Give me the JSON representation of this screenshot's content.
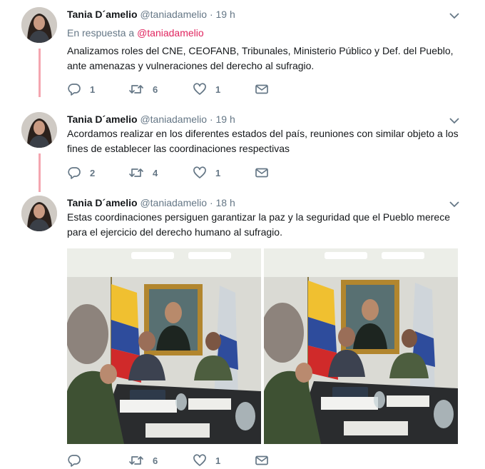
{
  "tweets": [
    {
      "fullname": "Tania D´amelio",
      "username": "@taniadamelio",
      "dot": "·",
      "time": "19 h",
      "reply_prefix": "En respuesta a",
      "reply_handle": "@taniadamelio",
      "text": "Analizamos roles del CNE, CEOFANB, Tribunales, Ministerio Público y Def. del Pueblo, ante amenazas y vulneraciones del derecho al sufragio.",
      "replies": "1",
      "retweets": "6",
      "likes": "1"
    },
    {
      "fullname": "Tania D´amelio",
      "username": "@taniadamelio",
      "dot": "·",
      "time": "19 h",
      "text": "Acordamos realizar en los diferentes estados del país, reuniones con similar objeto a los fines de establecer las coordinaciones respectivas",
      "replies": "2",
      "retweets": "4",
      "likes": "1"
    },
    {
      "fullname": "Tania D´amelio",
      "username": "@taniadamelio",
      "dot": "·",
      "time": "18 h",
      "text": "Estas coordinaciones persiguen garantizar  la paz y la seguridad que el Pueblo merece para el ejercicio del derecho humano al sufragio.",
      "replies": "",
      "retweets": "6",
      "likes": "1"
    }
  ],
  "icons": {
    "reply": "reply-icon",
    "retweet": "retweet-icon",
    "like": "heart-icon",
    "dm": "envelope-icon",
    "caret": "chevron-down-icon"
  },
  "colors": {
    "thread_line": "#f4a6b0",
    "mention": "#e0245e",
    "secondary_text": "#657786"
  }
}
